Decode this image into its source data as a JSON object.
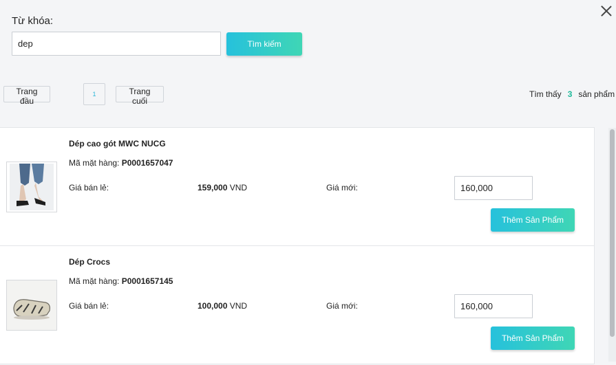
{
  "search": {
    "label": "Từ khóa:",
    "value": "dep",
    "button_label": "Tìm kiếm"
  },
  "pagination": {
    "first_label": "Trang đầu",
    "current_page": "1",
    "last_label": "Trang cuối"
  },
  "result_summary": {
    "prefix": "Tìm thấy",
    "count": "3",
    "suffix": "sản phẩm"
  },
  "products": [
    {
      "name": "Dép cao gót MWC NUCG",
      "code_label": "Mã mặt hàng:",
      "code": "P0001657047",
      "retail_label": "Giá bán lẻ:",
      "retail_price": "159,000",
      "currency": "VND",
      "new_price_label": "Giá mới:",
      "new_price": "160,000",
      "add_button_label": "Thêm Sản Phẩm"
    },
    {
      "name": "Dép Crocs",
      "code_label": "Mã mặt hàng:",
      "code": "P0001657145",
      "retail_label": "Giá bán lẻ:",
      "retail_price": "100,000",
      "currency": "VND",
      "new_price_label": "Giá mới:",
      "new_price": "160,000",
      "add_button_label": "Thêm Sản Phẩm"
    }
  ],
  "icons": {
    "close": "close-icon"
  },
  "colors": {
    "accent_start": "#26c1dc",
    "accent_end": "#3fd6b5",
    "count_color": "#1fb99a"
  }
}
